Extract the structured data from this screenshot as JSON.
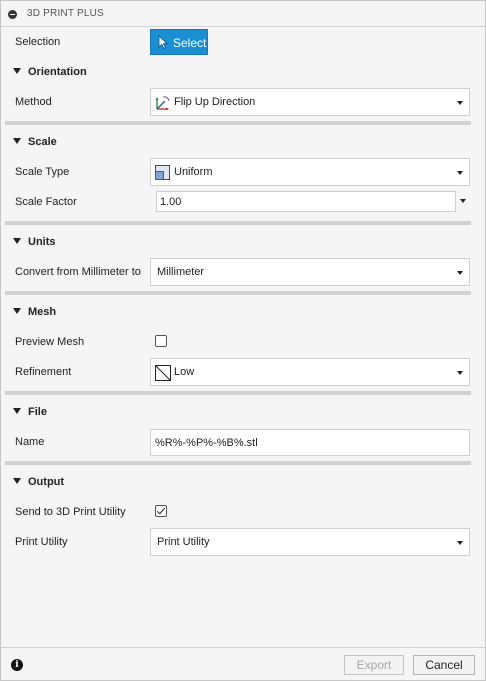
{
  "title": "3D PRINT PLUS",
  "selection": {
    "label": "Selection",
    "button": "Select"
  },
  "orientation": {
    "header": "Orientation",
    "method_label": "Method",
    "method_value": "Flip Up Direction"
  },
  "scale": {
    "header": "Scale",
    "type_label": "Scale Type",
    "type_value": "Uniform",
    "factor_label": "Scale Factor",
    "factor_value": "1.00"
  },
  "units": {
    "header": "Units",
    "convert_label": "Convert from Millimeter to",
    "convert_value": "Millimeter"
  },
  "mesh": {
    "header": "Mesh",
    "preview_label": "Preview Mesh",
    "preview_checked": false,
    "refinement_label": "Refinement",
    "refinement_value": "Low"
  },
  "file": {
    "header": "File",
    "name_label": "Name",
    "name_value": "%R%-%P%-%B%.stl"
  },
  "output": {
    "header": "Output",
    "send_label": "Send to 3D Print Utility",
    "send_checked": true,
    "utility_label": "Print Utility",
    "utility_value": "Print Utility"
  },
  "footer": {
    "export": "Export",
    "cancel": "Cancel",
    "export_enabled": false
  },
  "colors": {
    "accent": "#1b8fd4",
    "panel_bg": "#f5f5f5"
  }
}
